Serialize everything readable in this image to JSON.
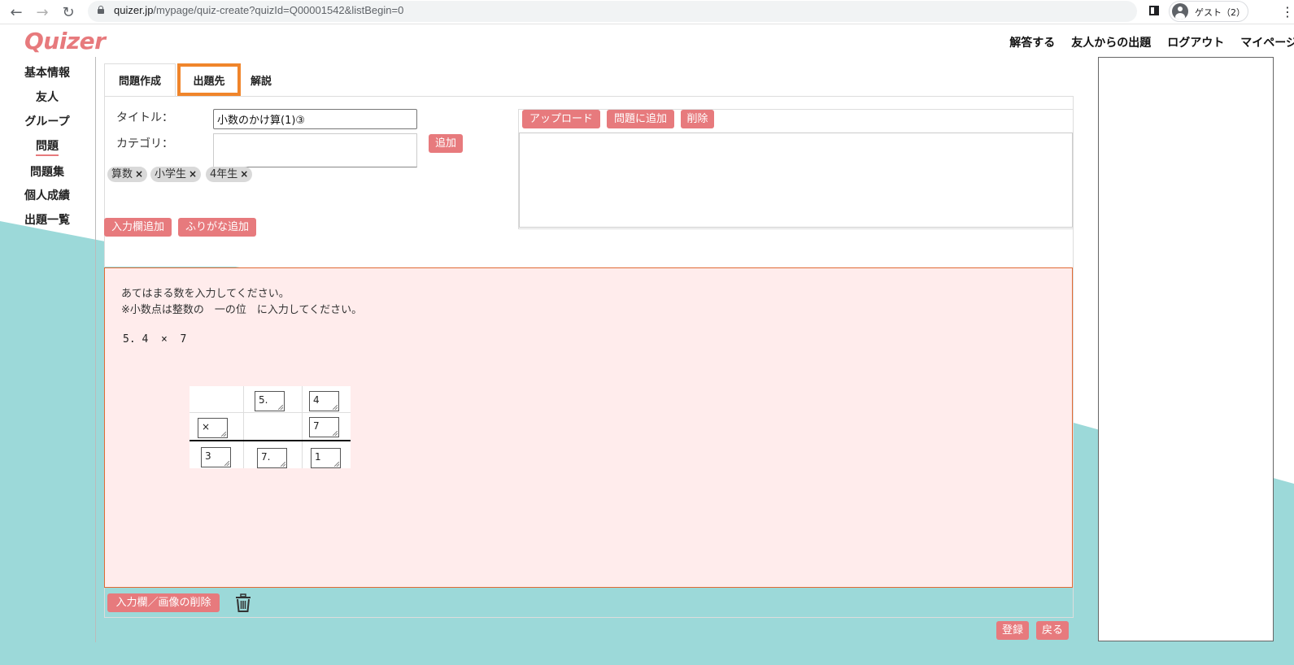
{
  "browser": {
    "url_host": "quizer.jp",
    "url_path": "/mypage/quiz-create?quizId=Q00001542&listBegin=0",
    "profile": "ゲスト（2）"
  },
  "site": {
    "logo": "Quizer",
    "nav": [
      "解答する",
      "友人からの出題",
      "ログアウト",
      "マイページ"
    ]
  },
  "sidebar": {
    "items": [
      "基本情報",
      "友人",
      "グループ",
      "問題",
      "問題集",
      "個人成績",
      "出題一覧"
    ],
    "active_index": 3
  },
  "tabs": {
    "create": "問題作成",
    "destination": "出題先",
    "explanation": "解説"
  },
  "form": {
    "title_label": "タイトル：",
    "title_value": "小数のかけ算(1)③",
    "category_label": "カテゴリ：",
    "category_value": "",
    "add_category": "追加",
    "tags": [
      "算数",
      "小学生",
      "4年生"
    ],
    "tag_remove": "×",
    "add_input_field": "入力欄追加",
    "add_furigana": "ふりがな追加"
  },
  "upload": {
    "upload_button": "アップロード",
    "add_to_question": "問題に追加",
    "delete": "削除"
  },
  "question": {
    "line1": "あてはまる数を入力してください。",
    "line2": "※小数点は整数の　一の位　に入力してください。",
    "expression": "5. 4  ×  7",
    "grid": {
      "row1": [
        "",
        "5.",
        "4"
      ],
      "row2": [
        "×",
        "",
        "7"
      ],
      "row3": [
        "3",
        "7.",
        "1"
      ]
    }
  },
  "footer": {
    "delete_field_image": "入力欄／画像の削除",
    "register": "登録",
    "back": "戻る"
  },
  "colors": {
    "accent": "#e77a7d",
    "teal": "#9cd9d9",
    "highlight": "#f0852b",
    "question_bg": "#ffecec"
  }
}
